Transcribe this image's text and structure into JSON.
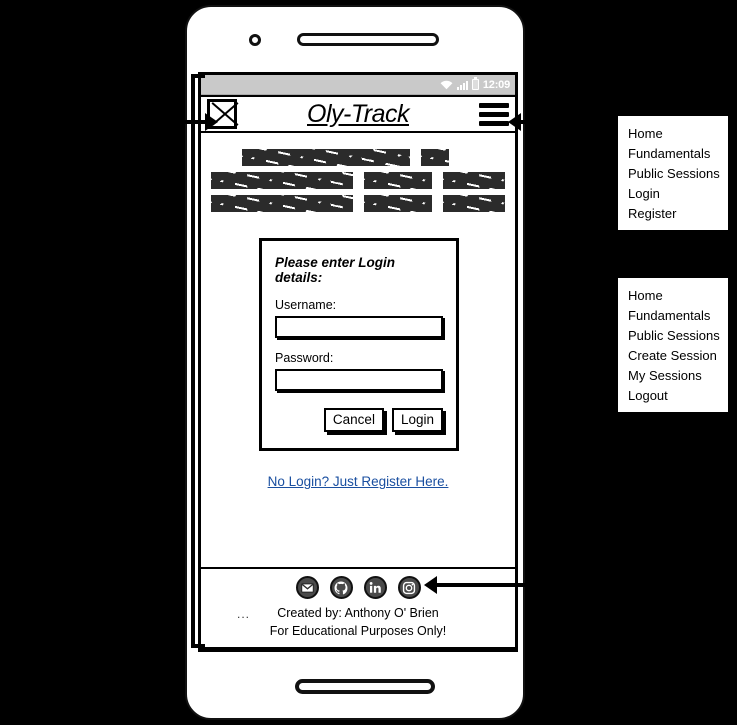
{
  "app": {
    "name": "Oly-Track",
    "logo_icon": "x-box-logo-icon",
    "menu_icon": "hamburger-menu-icon"
  },
  "status_bar": {
    "time": "12:09",
    "wifi_icon": "wifi-icon",
    "signal_icon": "cellular-signal-icon",
    "battery_icon": "battery-icon"
  },
  "content": {
    "placeholder_note": "scribbled placeholder text lines"
  },
  "login_form": {
    "heading": "Please enter Login details:",
    "username_label": "Username:",
    "username_value": "",
    "username_placeholder": "",
    "password_label": "Password:",
    "password_value": "",
    "password_placeholder": "",
    "cancel_label": "Cancel",
    "login_label": "Login"
  },
  "register": {
    "link_text": "No Login? Just Register Here.",
    "link_color": "#1a4fa0"
  },
  "footer": {
    "ellipsis": "...",
    "line1": "Created by: Anthony O' Brien",
    "line2": "For Educational Purposes Only!",
    "social": [
      {
        "name": "email-icon",
        "label": "Email"
      },
      {
        "name": "github-icon",
        "label": "GitHub"
      },
      {
        "name": "linkedin-icon",
        "label": "LinkedIn"
      },
      {
        "name": "instagram-icon",
        "label": "Instagram"
      }
    ]
  },
  "menus": {
    "guest": {
      "items": [
        {
          "label": "Home"
        },
        {
          "label": "Fundamentals"
        },
        {
          "label": "Public Sessions"
        },
        {
          "label": "Login"
        },
        {
          "label": "Register"
        }
      ]
    },
    "user": {
      "items": [
        {
          "label": "Home"
        },
        {
          "label": "Fundamentals"
        },
        {
          "label": "Public Sessions"
        },
        {
          "label": "Create Session"
        },
        {
          "label": "My Sessions"
        },
        {
          "label": "Logout"
        }
      ]
    }
  },
  "colors": {
    "background": "#000000",
    "screen": "#ffffff",
    "status_bar": "#c9c9c9",
    "link": "#1a4fa0",
    "social_icon": "#4a4a4a"
  }
}
